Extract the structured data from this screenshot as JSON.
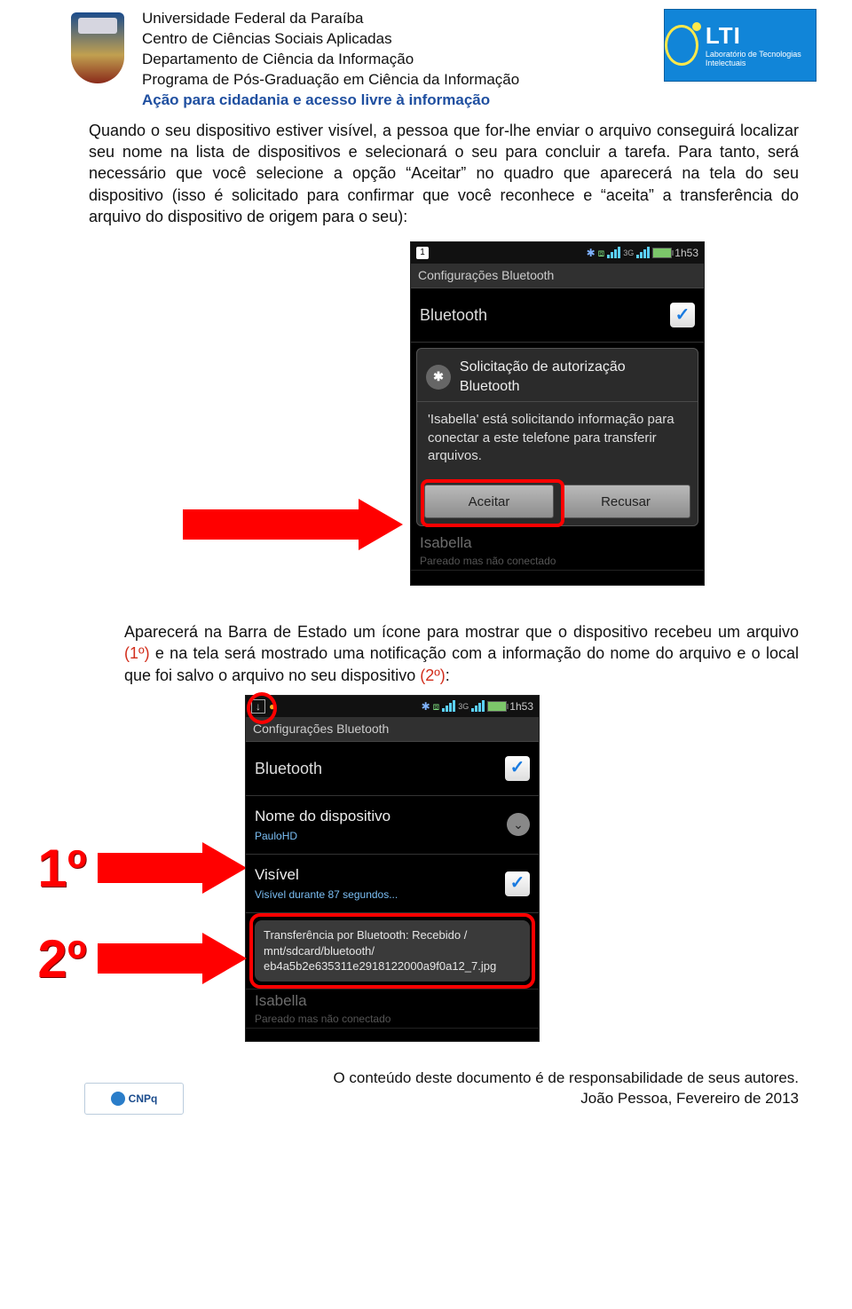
{
  "header": {
    "l1": "Universidade Federal da Paraíba",
    "l2": "Centro de Ciências Sociais Aplicadas",
    "l3": "Departamento de Ciência da Informação",
    "l4": "Programa de Pós-Graduação em Ciência da Informação",
    "acao": "Ação para cidadania e acesso livre à informação",
    "lti_big": "LTI",
    "lti_sub": "Laboratório de Tecnologias Intelectuais"
  },
  "para1": "Quando o seu dispositivo estiver visível, a pessoa que for-lhe enviar o arquivo conseguirá localizar seu nome na lista de dispositivos e selecionará o seu para concluir a tarefa. Para tanto, será necessário que você selecione a opção “Aceitar” no quadro que aparecerá na tela do seu dispositivo (isso é solicitado para confirmar que você reconhece e “aceita” a transferência do arquivo do dispositivo de origem para o seu):",
  "shot1": {
    "time": "1h53",
    "cal": "1",
    "title": "Configurações Bluetooth",
    "bt": "Bluetooth",
    "dlg_title": "Solicitação de autorização Bluetooth",
    "dlg_body": "'Isabella' está solicitando informação para conectar a este telefone para transferir arquivos.",
    "accept": "Aceitar",
    "decline": "Recusar",
    "ghost_name": "Isabella",
    "ghost_sub": "Pareado mas não conectado"
  },
  "para2_a": "Aparecerá na Barra de Estado um ícone para mostrar que o dispositivo recebeu um arquivo ",
  "para2_b": "(1º)",
  "para2_c": " e na tela será mostrado uma notificação com a informação do nome do arquivo e o local que foi salvo o arquivo no seu dispositivo ",
  "para2_d": "(2º)",
  "para2_e": ":",
  "marks": {
    "m1": "1º",
    "m2": "2º"
  },
  "shot2": {
    "time": "1h53",
    "title": "Configurações Bluetooth",
    "bt": "Bluetooth",
    "devname_lbl": "Nome do dispositivo",
    "devname_val": "PauloHD",
    "vis_lbl": "Visível",
    "vis_sub": "Visível durante 87 segundos...",
    "toast": "Transferência por Bluetooth: Recebido / mnt/sdcard/bluetooth/ eb4a5b2e635311e2918122000a9f0a12_7.jpg",
    "ghost_name": "Isabella",
    "ghost_sub": "Pareado mas não conectado"
  },
  "footer": {
    "cnpq": "CNPq",
    "line1": "O conteúdo deste documento é de responsabilidade de seus autores.",
    "line2": "João Pessoa, Fevereiro de 2013"
  }
}
